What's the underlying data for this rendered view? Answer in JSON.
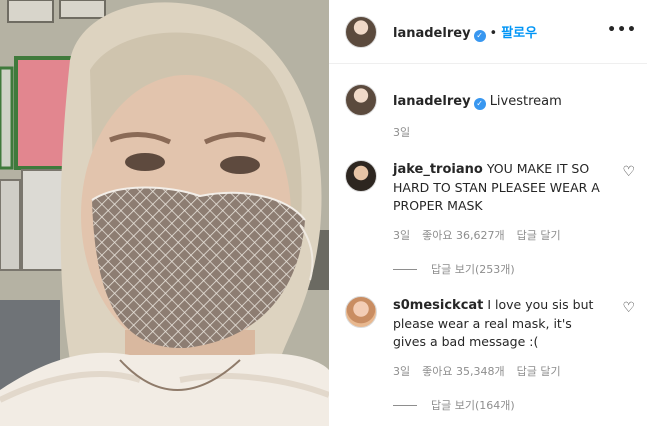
{
  "post": {
    "username": "lanadelrey",
    "follow_label": "팔로우",
    "more_icon": "more-horizontal-icon",
    "verified_icon": "verified-badge-icon"
  },
  "caption": {
    "username": "lanadelrey",
    "text": "Livestream",
    "time": "3일"
  },
  "comments": [
    {
      "username": "jake_troiano",
      "text": "YOU MAKE IT SO HARD TO STAN PLEASEE WEAR A PROPER MASK",
      "time": "3일",
      "likes": "좋아요 36,627개",
      "reply_label": "답글 달기",
      "view_replies": "답글 보기(253개)"
    },
    {
      "username": "s0mesickcat",
      "text": "I love you sis but please wear a real mask, it's gives a bad message :(",
      "time": "3일",
      "likes": "좋아요 35,348개",
      "reply_label": "답글 달기",
      "view_replies": "답글 보기(164개)"
    }
  ],
  "colors": {
    "accent": "#0095f6",
    "verified": "#3897f0",
    "muted": "#8e8e8e",
    "text": "#262626"
  }
}
